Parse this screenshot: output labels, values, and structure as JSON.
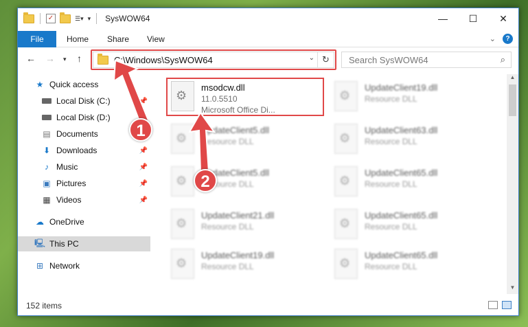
{
  "window": {
    "title": "SysWOW64"
  },
  "ribbon": {
    "tabs": [
      "File",
      "Home",
      "Share",
      "View"
    ]
  },
  "address": {
    "path": "C:\\Windows\\SysWOW64"
  },
  "search": {
    "placeholder": "Search SysWOW64"
  },
  "sidebar": {
    "items": [
      {
        "label": "Quick access",
        "icon": "star-icon"
      },
      {
        "label": "Local Disk (C:)",
        "icon": "drive-icon",
        "pinned": true
      },
      {
        "label": "Local Disk (D:)",
        "icon": "drive-icon",
        "pinned": true
      },
      {
        "label": "Documents",
        "icon": "documents-icon",
        "pinned": false
      },
      {
        "label": "Downloads",
        "icon": "downloads-icon",
        "pinned": true
      },
      {
        "label": "Music",
        "icon": "music-icon",
        "pinned": true
      },
      {
        "label": "Pictures",
        "icon": "pictures-icon",
        "pinned": true
      },
      {
        "label": "Videos",
        "icon": "videos-icon",
        "pinned": true
      },
      {
        "label": "OneDrive",
        "icon": "cloud-icon"
      },
      {
        "label": "This PC",
        "icon": "computer-icon",
        "selected": true
      },
      {
        "label": "Network",
        "icon": "network-icon"
      }
    ]
  },
  "files": {
    "primary": {
      "name": "msodcw.dll",
      "version": "11.0.5510",
      "description": "Microsoft Office Di..."
    },
    "left_column": [
      {
        "name": "UpdateClient5.dll",
        "type": "Resource DLL"
      },
      {
        "name": "UpdateClient5.dll",
        "type": "Resource DLL"
      },
      {
        "name": "UpdateClient21.dll",
        "type": "Resource DLL"
      },
      {
        "name": "UpdateClient19.dll",
        "type": "Resource DLL"
      }
    ],
    "right_column": [
      {
        "name": "UpdateClient19.dll",
        "type": "Resource DLL"
      },
      {
        "name": "UpdateClient63.dll",
        "type": "Resource DLL"
      },
      {
        "name": "UpdateClient65.dll",
        "type": "Resource DLL"
      },
      {
        "name": "UpdateClient65.dll",
        "type": "Resource DLL"
      },
      {
        "name": "UpdateClient65.dll",
        "type": "Resource DLL"
      }
    ]
  },
  "status": {
    "item_count": "152 items"
  },
  "annotations": {
    "step1": "1",
    "step2": "2",
    "color": "#e04848"
  }
}
